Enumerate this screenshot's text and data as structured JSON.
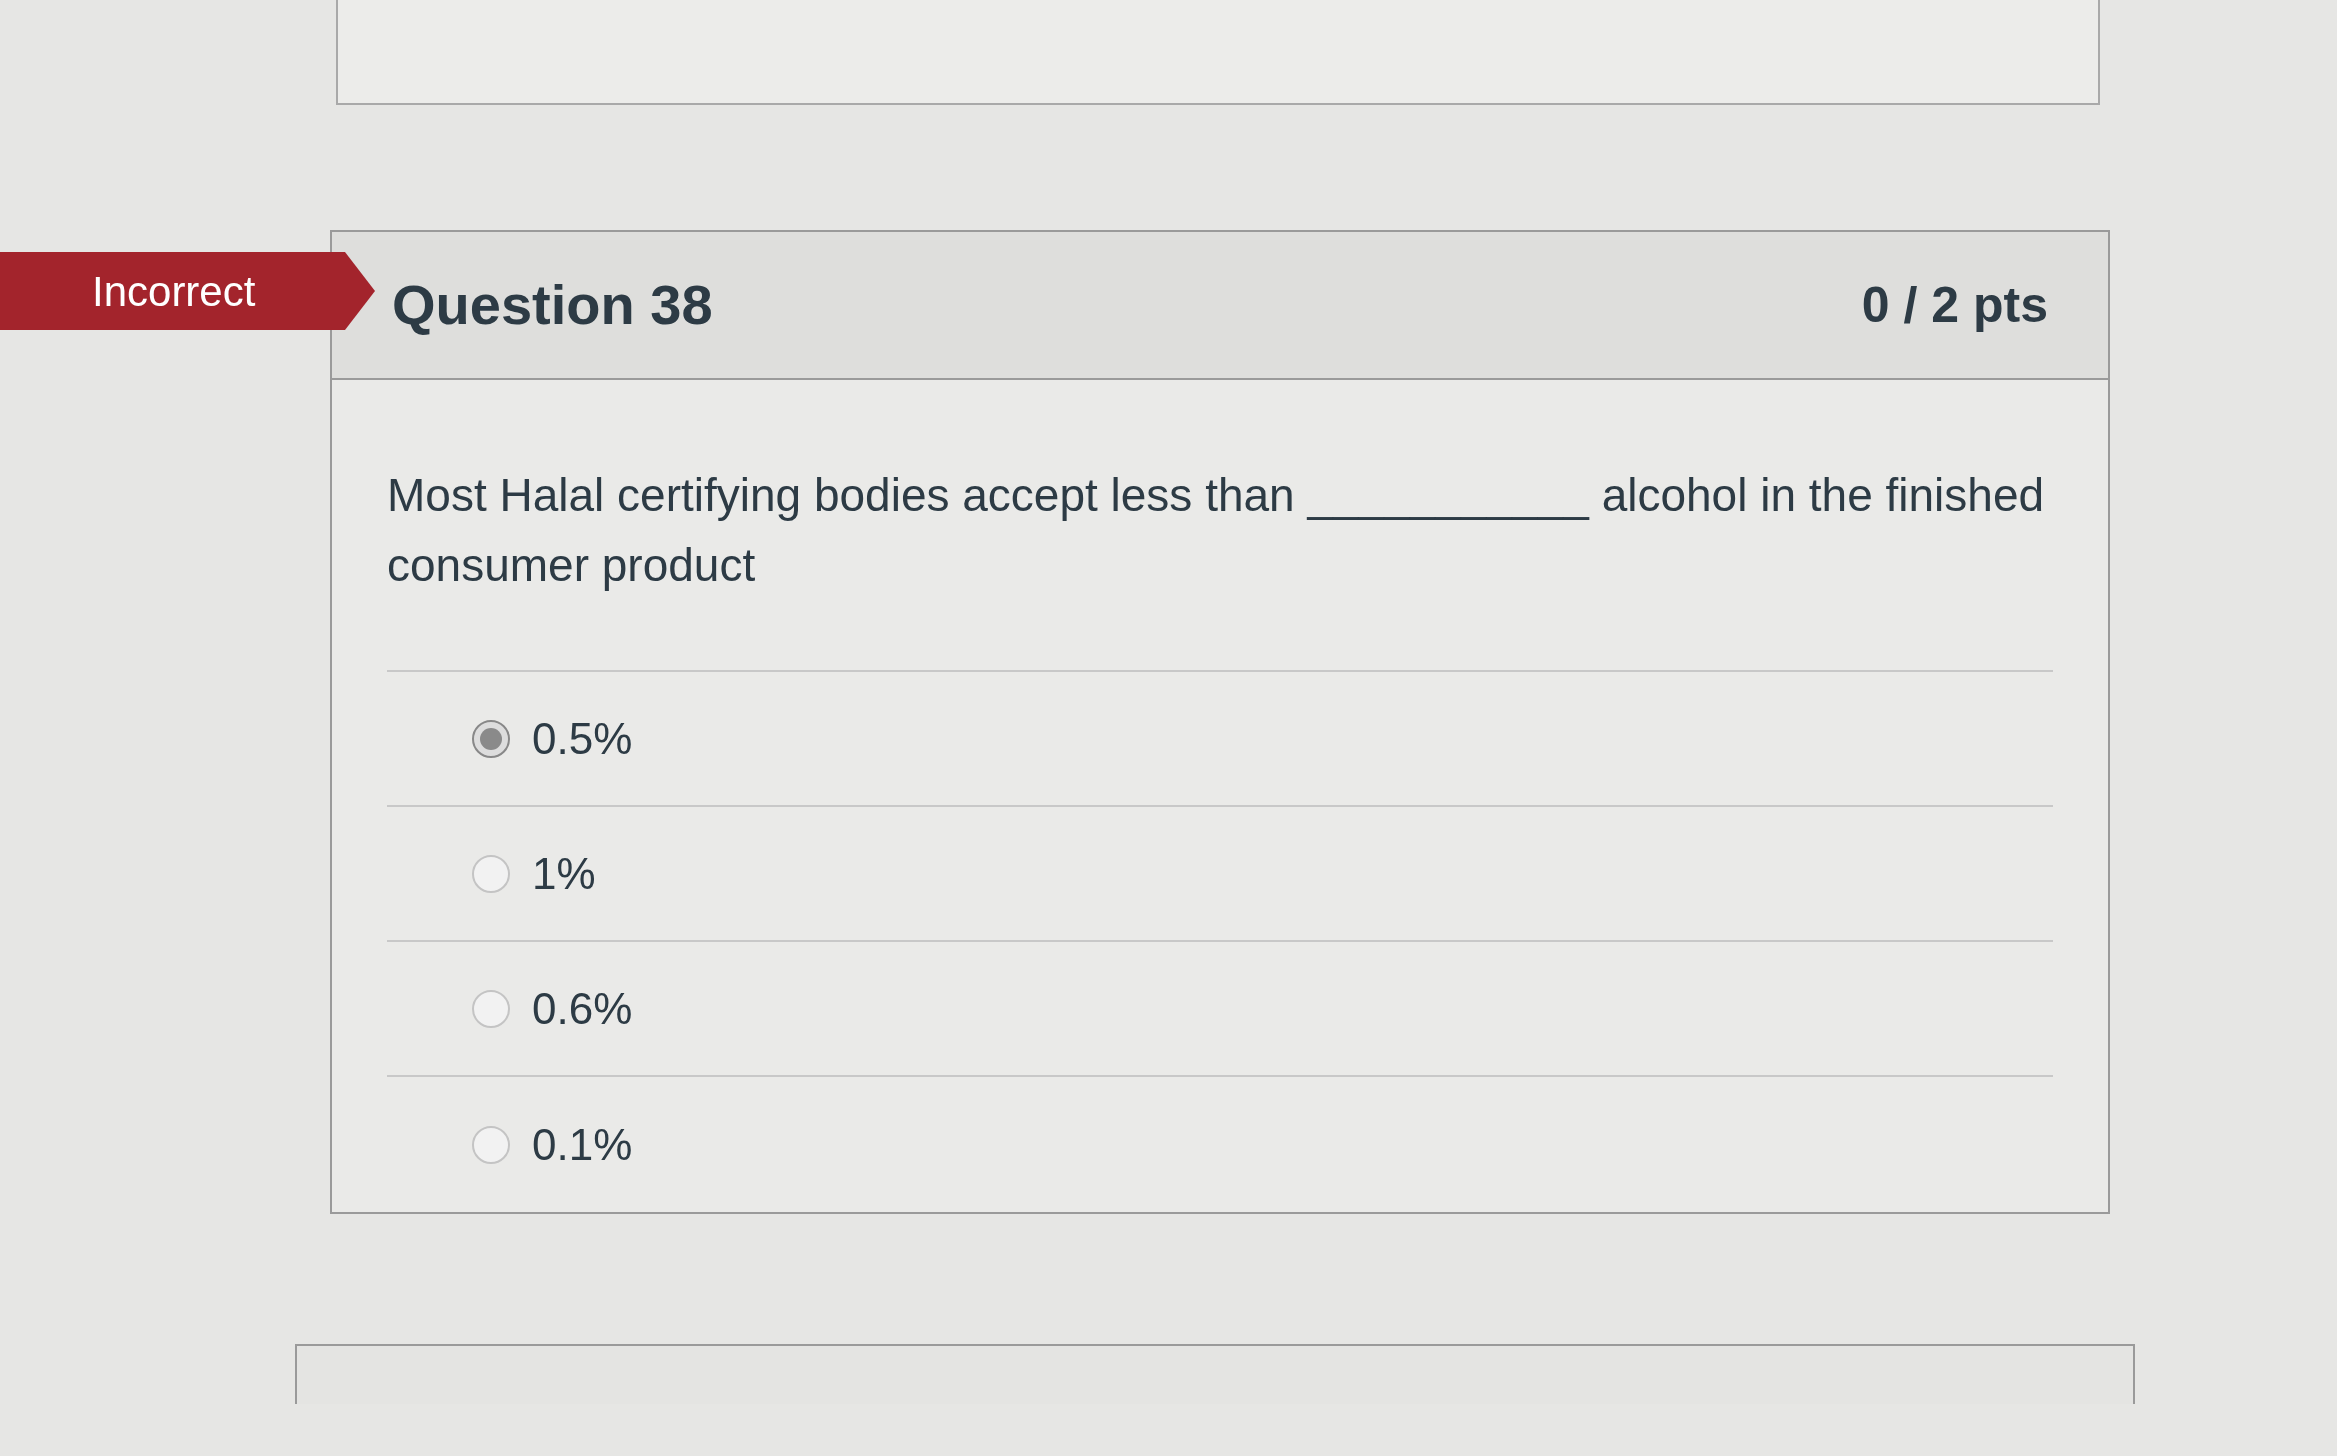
{
  "question": {
    "status": "Incorrect",
    "title": "Question 38",
    "points": "0 / 2 pts",
    "text": "Most Halal certifying bodies accept less than ___________ alcohol in the finished consumer product",
    "answers": [
      {
        "label": "0.5%",
        "selected": true
      },
      {
        "label": "1%",
        "selected": false
      },
      {
        "label": "0.6%",
        "selected": false
      },
      {
        "label": "0.1%",
        "selected": false
      }
    ]
  }
}
